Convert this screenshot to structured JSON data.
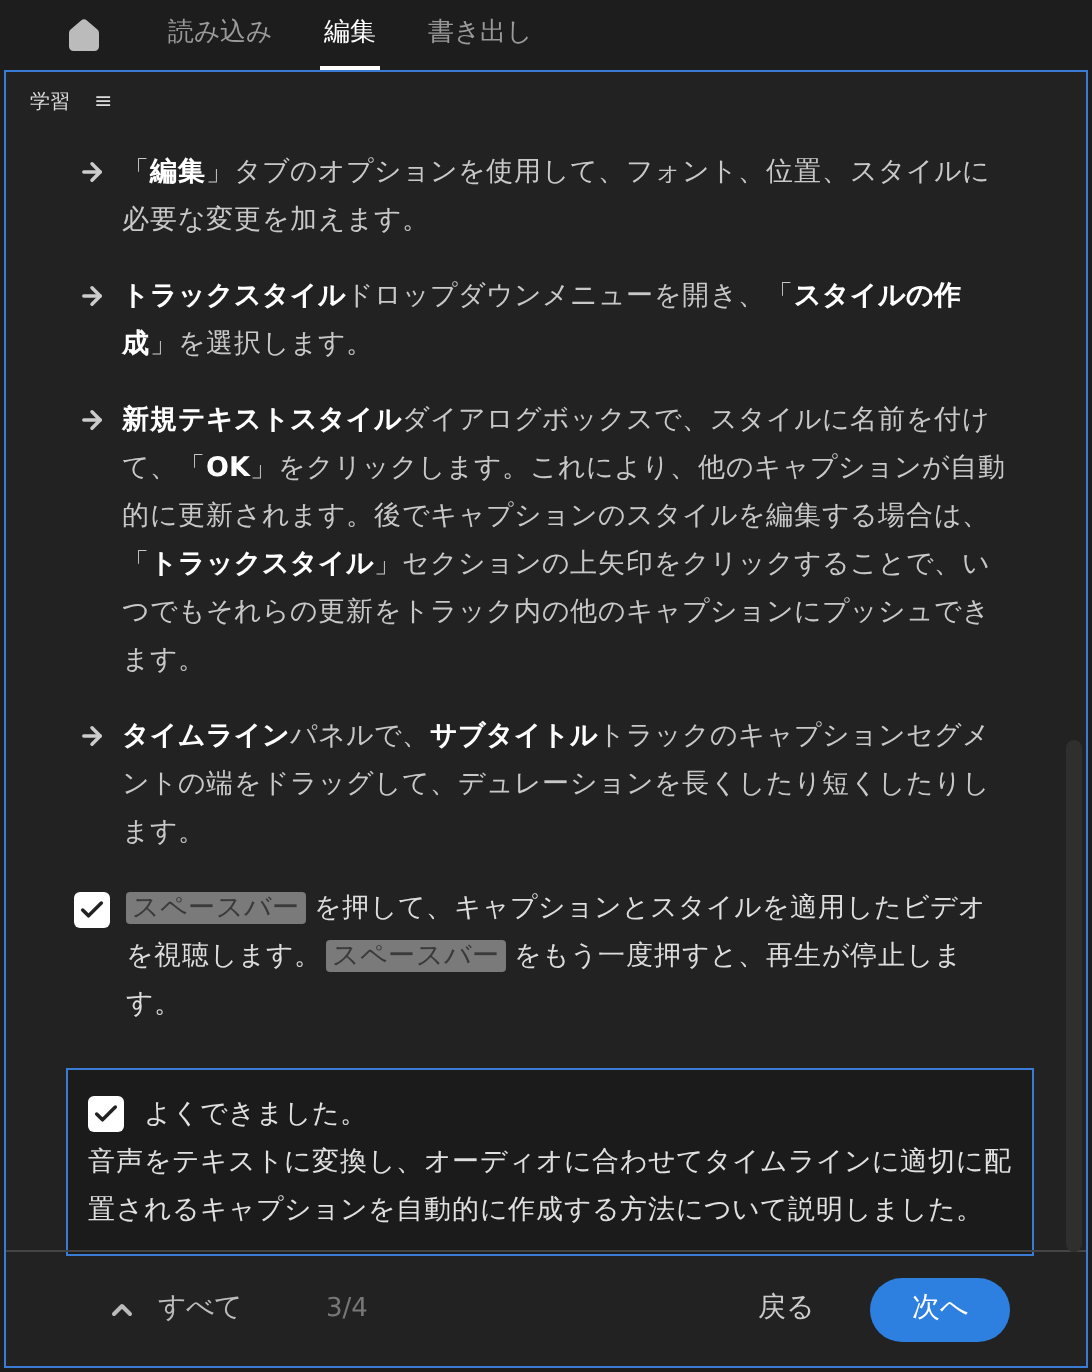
{
  "tabs": [
    {
      "label": "読み込み",
      "selected": false
    },
    {
      "label": "編集",
      "selected": true
    },
    {
      "label": "書き出し",
      "selected": false
    }
  ],
  "panel": {
    "title": "学習",
    "menu_icon": "≡"
  },
  "steps": [
    "「**編集**」タブのオプションを使用して、フォント、位置、スタイルに必要な変更を加えます。",
    "**トラックスタイル**ドロップダウンメニューを開き、「**スタイルの作成**」を選択します。",
    "**新規テキストスタイル**ダイアログボックスで、スタイルに名前を付けて、「**OK**」をクリックします。これにより、他のキャプションが自動的に更新されます。後でキャプションのスタイルを編集する場合は、「**トラックスタイル**」セクションの上矢印をクリックすることで、いつでもそれらの更新をトラック内の他のキャプションにプッシュできます。",
    "**タイムライン**パネルで、**サブタイトル**トラックのキャプションセグメントの端をドラッグして、デュレーションを長くしたり短くしたりします。"
  ],
  "task": {
    "checked": true,
    "segments": [
      {
        "kind": "key",
        "text": "スペースバー"
      },
      {
        "kind": "text",
        "text": "を押して、キャプションとスタイルを適用したビデオを視聴します。"
      },
      {
        "kind": "key",
        "text": "スペースバー"
      },
      {
        "kind": "text",
        "text": "をもう一度押すと、再生が停止します。"
      }
    ]
  },
  "completion": {
    "checked": true,
    "title": "よくできました。",
    "body": "音声をテキストに変換し、オーディオに合わせてタイムラインに適切に配置されるキャプションを自動的に作成する方法について説明しました。"
  },
  "footer": {
    "all_label": "すべて",
    "progress": "3/4",
    "back": "戻る",
    "next": "次へ"
  }
}
